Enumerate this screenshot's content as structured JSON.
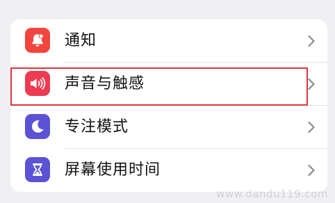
{
  "settings_list": {
    "items": [
      {
        "label": "通知",
        "icon": "bell-badge-icon",
        "icon_color": "#f2453d"
      },
      {
        "label": "声音与触感",
        "icon": "speaker-wave-icon",
        "icon_color": "#ee3b52"
      },
      {
        "label": "专注模式",
        "icon": "moon-icon",
        "icon_color": "#5b52d6"
      },
      {
        "label": "屏幕使用时间",
        "icon": "hourglass-icon",
        "icon_color": "#5b52d6"
      }
    ]
  },
  "highlight": {
    "target": "声音与触感",
    "color": "#e0343b"
  },
  "watermark": "www.dandu119.com"
}
